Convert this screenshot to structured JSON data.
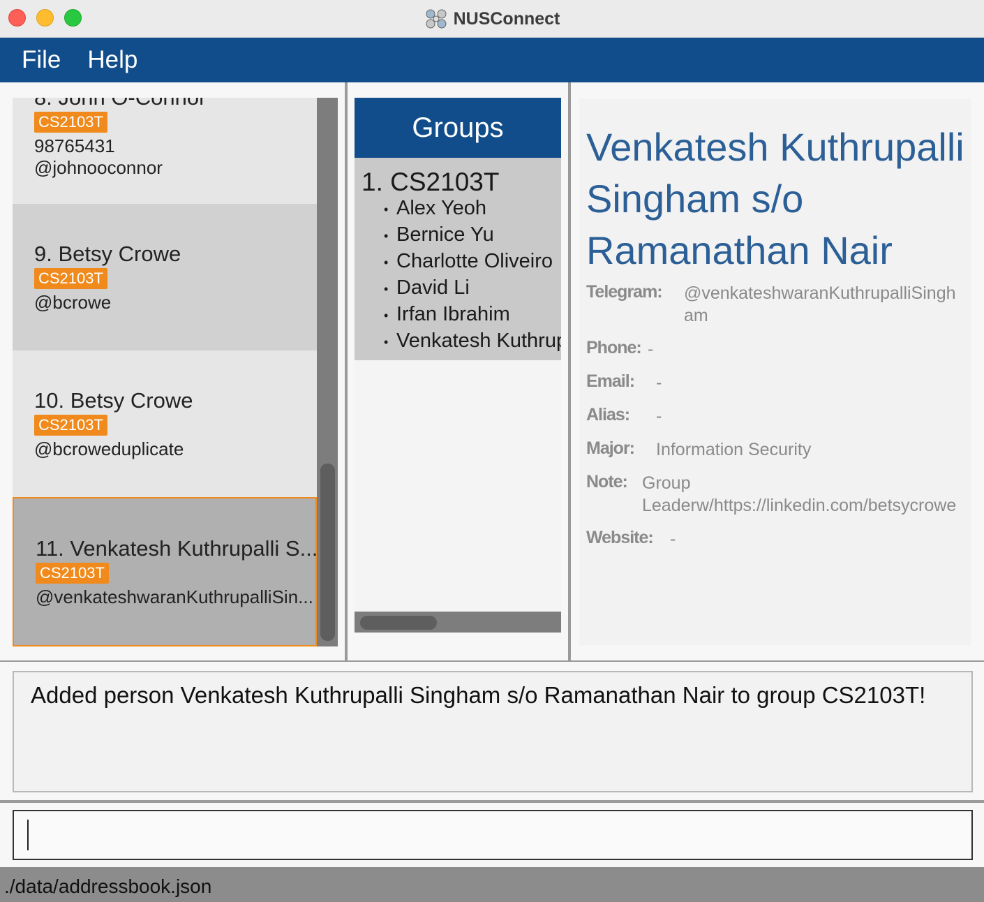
{
  "window": {
    "title": "NUSConnect"
  },
  "menu": {
    "file": "File",
    "help": "Help"
  },
  "persons": [
    {
      "index": "8.",
      "name": "John O-Connor",
      "tag": "CS2103T",
      "phone": "98765431",
      "telegram": "@johnooconnor"
    },
    {
      "index": "9.",
      "name": "Betsy Crowe",
      "tag": "CS2103T",
      "telegram": "@bcrowe"
    },
    {
      "index": "10.",
      "name": "Betsy Crowe",
      "tag": "CS2103T",
      "telegram": "@bcroweduplicate"
    },
    {
      "index": "11.",
      "name": "Venkatesh Kuthrupalli S...",
      "tag": "CS2103T",
      "telegram": "@venkateshwaranKuthrupalliSin..."
    }
  ],
  "groups": {
    "header": "Groups",
    "list": [
      {
        "title": "1.  CS2103T",
        "members": [
          "Alex Yeoh",
          "Bernice Yu",
          "Charlotte Oliveiro",
          "David Li",
          "Irfan Ibrahim",
          "Venkatesh Kuthrupalli Singham s/o Ramanathan Nair"
        ]
      }
    ]
  },
  "detail": {
    "name": "Venkatesh Kuthrupalli Singham s/o Ramanathan Nair",
    "fields": {
      "telegram_label": "Telegram:",
      "telegram": "@venkateshwaranKuthrupalliSingham",
      "phone_label": "Phone:",
      "phone": "-",
      "email_label": "Email:",
      "email": "-",
      "alias_label": "Alias:",
      "alias": "-",
      "major_label": "Major:",
      "major": "Information Security",
      "note_label": "Note:",
      "note": "Group Leaderw/https://linkedin.com/betsycrowe",
      "website_label": "Website:",
      "website": "-"
    }
  },
  "result": "Added person Venkatesh Kuthrupalli Singham s/o Ramanathan Nair to group CS2103T!",
  "command": {
    "value": ""
  },
  "status": {
    "path": "./data/addressbook.json"
  },
  "colors": {
    "accent": "#114d8a",
    "tag": "#f08a1c",
    "name": "#2b5f96"
  }
}
